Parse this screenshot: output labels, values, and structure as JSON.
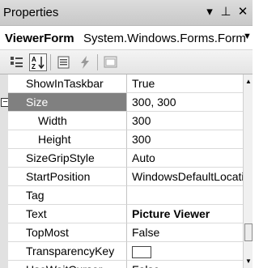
{
  "window": {
    "title": "Properties",
    "pin_glyph": "▾ ⊥",
    "close_glyph": "✕"
  },
  "object_selector": {
    "name": "ViewerForm",
    "type": "System.Windows.Forms.Form",
    "dropdown_glyph": "▼"
  },
  "toolbar": {
    "tools": [
      {
        "icon": "categorized-icon",
        "active": false
      },
      {
        "icon": "alphabetical-icon",
        "active": true
      },
      {
        "icon": "properties-icon",
        "active": false
      },
      {
        "icon": "events-icon",
        "active": false
      },
      {
        "icon": "property-pages-icon",
        "active": false
      }
    ]
  },
  "properties": [
    {
      "name": "ShowInTaskbar",
      "value": "True"
    },
    {
      "name": "Size",
      "value": "300, 300",
      "expander": "⊟",
      "selected": true
    },
    {
      "name": "Width",
      "value": "300",
      "child": true
    },
    {
      "name": "Height",
      "value": "300",
      "child": true
    },
    {
      "name": "SizeGripStyle",
      "value": "Auto"
    },
    {
      "name": "StartPosition",
      "value": "WindowsDefaultLocation"
    },
    {
      "name": "Tag",
      "value": ""
    },
    {
      "name": "Text",
      "value": "Picture Viewer",
      "bold": true
    },
    {
      "name": "TopMost",
      "value": "False"
    },
    {
      "name": "TransparencyKey",
      "value": "",
      "swatch": true
    },
    {
      "name": "UseWaitCursor",
      "value": "False"
    }
  ],
  "colors": {
    "selected_row": "#808080",
    "header_bg": "#dcdcdc",
    "toolbar_bg": "#ececec",
    "margin_bg": "#e1e1e1"
  }
}
